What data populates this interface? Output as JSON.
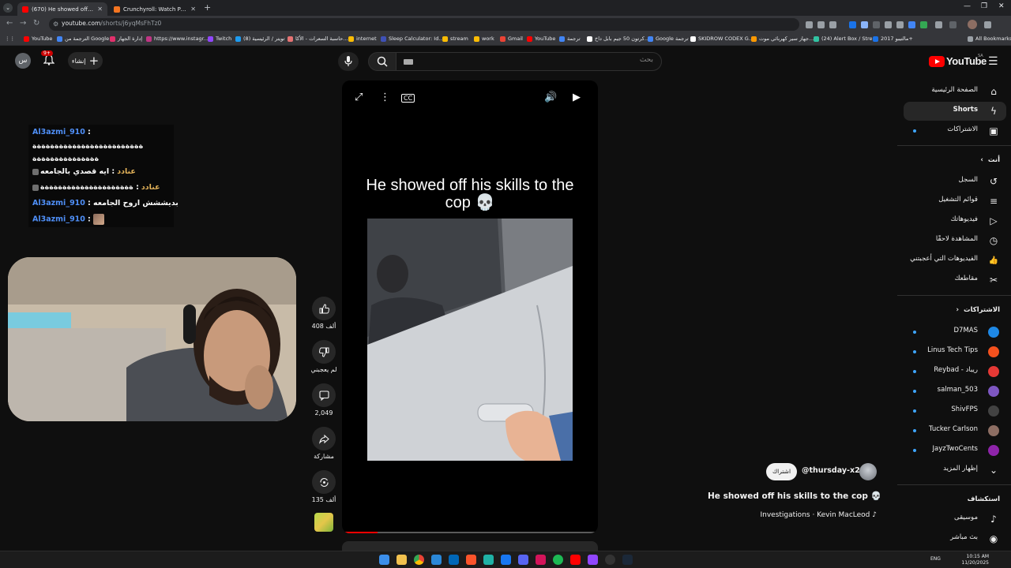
{
  "browser": {
    "tabs": [
      {
        "label": "(670) He showed off his skills to",
        "active": true,
        "favicon_color": "#ff0000"
      },
      {
        "label": "Crunchyroll: Watch Popular Ani",
        "active": false,
        "favicon_color": "#f47521"
      }
    ],
    "url_host": "youtube.com",
    "url_path": "/shorts/j6yqMsFhTz0",
    "bookmarks": [
      {
        "label": "YouTube",
        "color": "#ff0000"
      },
      {
        "label": "الترجمة من Google",
        "color": "#4285f4"
      },
      {
        "label": "إدارة الجهاز",
        "color": "#e1306c"
      },
      {
        "label": "https://www.instagr...",
        "color": "#c13584"
      },
      {
        "label": "Twitch",
        "color": "#9146ff"
      },
      {
        "label": "تويتر / الرئيسية (8)",
        "color": "#1d9bf0"
      },
      {
        "label": "حاسبة السعرات - الأكا...",
        "color": "#e57373"
      },
      {
        "label": "internet",
        "color": "#fbbc04"
      },
      {
        "label": "Sleep Calculator: Id...",
        "color": "#3f51b5"
      },
      {
        "label": "stream",
        "color": "#fbbc04"
      },
      {
        "label": "work",
        "color": "#fbbc04"
      },
      {
        "label": "Gmail",
        "color": "#ea4335"
      },
      {
        "label": "YouTube",
        "color": "#ff0000"
      },
      {
        "label": "ترجمة",
        "color": "#4285f4"
      },
      {
        "label": "كرتون 50 جيم بابل داخ...",
        "color": "#ffffff"
      },
      {
        "label": "Google ترجمة",
        "color": "#4285f4"
      },
      {
        "label": "SKIDROW CODEX G...",
        "color": "#ffffff"
      },
      {
        "label": "جهاز سير كهربائي موت...",
        "color": "#ff9900"
      },
      {
        "label": "(24) Alert Box / Stre...",
        "color": "#31c3a2"
      },
      {
        "label": "مالتيبو 2017+",
        "color": "#1a73e8"
      }
    ],
    "all_bookmarks": "All Bookmarks"
  },
  "header": {
    "logo": "YouTube",
    "country_code": "SA",
    "search_placeholder": "بحث",
    "create_label": "إنشاء",
    "notif_count": "9+",
    "avatar_letter": "س"
  },
  "sidebar": {
    "main": [
      {
        "label": "الصفحة الرئيسية",
        "icon": "home-icon",
        "glyph": "⌂",
        "active": false
      },
      {
        "label": "Shorts",
        "icon": "shorts-icon",
        "glyph": "ϟ",
        "active": true
      },
      {
        "label": "الاشتراكات",
        "icon": "subscriptions-icon",
        "glyph": "▣",
        "active": false,
        "dot": true
      }
    ],
    "you_header": "أنت",
    "you": [
      {
        "label": "السجل",
        "icon": "history-icon",
        "glyph": "↺"
      },
      {
        "label": "قوائم التشغيل",
        "icon": "playlists-icon",
        "glyph": "≡"
      },
      {
        "label": "فيديوهاتك",
        "icon": "your-videos-icon",
        "glyph": "▷"
      },
      {
        "label": "المشاهدة لاحقًا",
        "icon": "watch-later-icon",
        "glyph": "◷"
      },
      {
        "label": "الفيديوهات التي أعجبتني",
        "icon": "liked-icon",
        "glyph": "👍"
      },
      {
        "label": "مقاطعك",
        "icon": "clips-icon",
        "glyph": "✂"
      }
    ],
    "subs_header": "الاشتراكات",
    "subs": [
      {
        "label": "D7MAS",
        "color": "#1e88e5"
      },
      {
        "label": "Linus Tech Tips",
        "color": "#f4511e"
      },
      {
        "label": "Reybad - ريباد",
        "color": "#e53935"
      },
      {
        "label": "salman_503",
        "color": "#7e57c2"
      },
      {
        "label": "ShivFPS",
        "color": "#424242"
      },
      {
        "label": "Tucker Carlson",
        "color": "#8d6e63"
      },
      {
        "label": "JayzTwoCents",
        "color": "#8e24aa"
      }
    ],
    "show_more": "إظهار المزيد",
    "explore_header": "استكشاف",
    "explore": [
      {
        "label": "موسيقى",
        "icon": "music-icon",
        "glyph": "♪"
      },
      {
        "label": "بث مباشر",
        "icon": "live-icon",
        "glyph": "◉"
      }
    ]
  },
  "short": {
    "caption": "He showed off his skills to the cop 💀",
    "likes": "408 ألف",
    "dislike_label": "لم يعجبني",
    "comments": "2,049",
    "share_label": "مشاركة",
    "remix_count": "135 ألف",
    "progress": 0.13,
    "channel_handle": "@thursday-x2s",
    "subscribe_label": "اشتراك",
    "title": "He showed off his skills to the cop 💀",
    "music": "Investigations · Kevin MacLeod ♪"
  },
  "chat": {
    "messages": [
      {
        "user": "Al3azmi_910",
        "user_style": "u1",
        "text": ":"
      },
      {
        "user": "",
        "user_style": "u1",
        "text": "ةةةةةةةةةةةةةةةةةةةةةةةةة"
      },
      {
        "user": "",
        "user_style": "u1",
        "text": "ةةةةةةةةةةةةةةة"
      },
      {
        "user": "عنادد",
        "user_style": "u2",
        "text": ": ايه قصدي بالجامعه",
        "badge": true
      },
      {
        "user": "عنادد",
        "user_style": "u2",
        "text": ": ةةةةةةةةةةةةةةةةةةةةة",
        "badge": true
      },
      {
        "user": "Al3azmi_910",
        "user_style": "u1",
        "text": ": بديششش اروح الجامعه"
      },
      {
        "user": "Al3azmi_910",
        "user_style": "u1",
        "text": ":",
        "emote": true
      }
    ]
  },
  "taskbar": {
    "lang": "ENG",
    "time": "10:15 AM",
    "date": "11/20/2025"
  }
}
